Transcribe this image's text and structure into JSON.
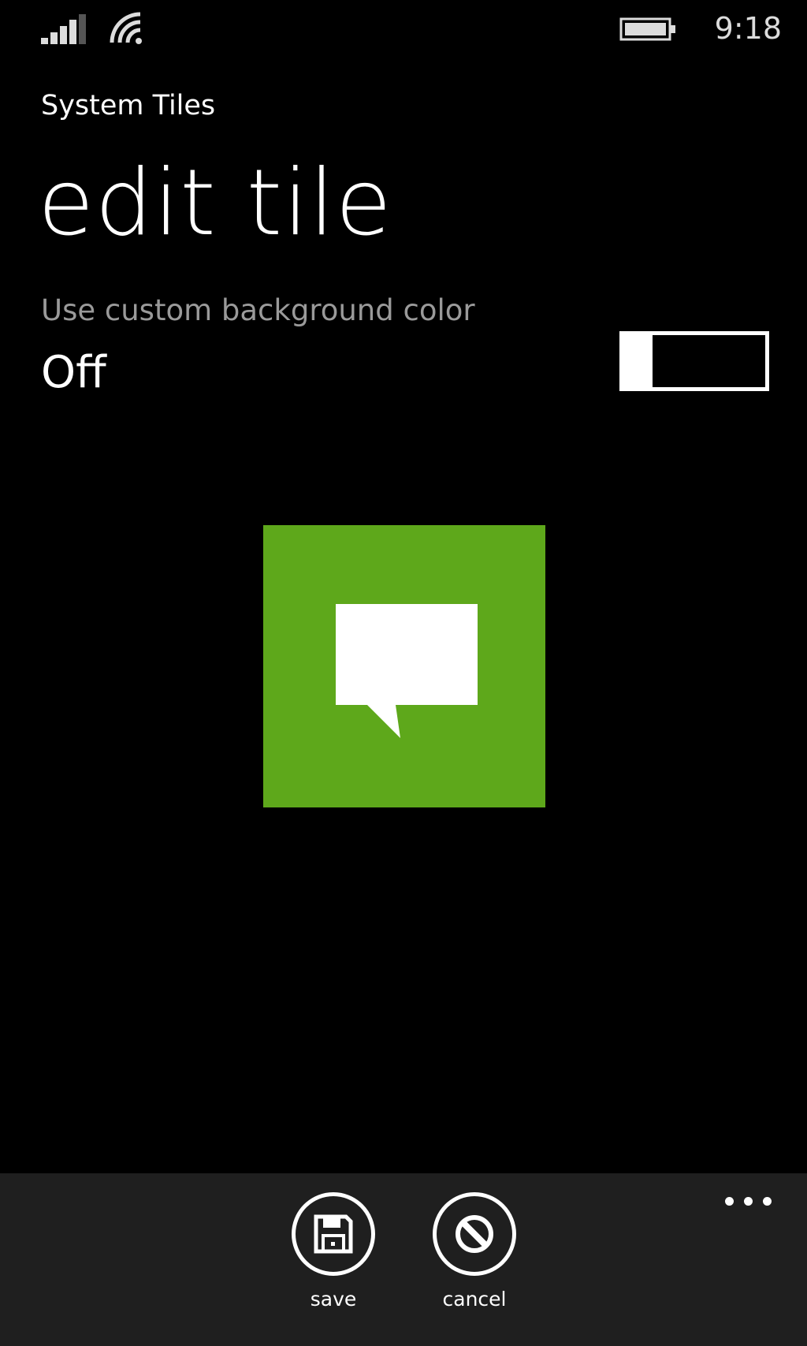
{
  "status_bar": {
    "time": "9:18",
    "icons": [
      "signal-strength-icon",
      "wifi-icon",
      "battery-icon"
    ]
  },
  "header": {
    "app_title": "System Tiles",
    "page_title": "edit tile"
  },
  "setting": {
    "label": "Use custom background color",
    "value": "Off",
    "enabled": false
  },
  "tile": {
    "background_color": "#5ea81b",
    "icon": "message-bubble-icon"
  },
  "app_bar": {
    "buttons": [
      {
        "label": "save",
        "icon": "save-icon"
      },
      {
        "label": "cancel",
        "icon": "cancel-icon"
      }
    ],
    "more_icon": "more-dots-icon"
  },
  "colors": {
    "background": "#000000",
    "app_bar": "#1f1f1f",
    "secondary_text": "#9a9a9a",
    "accent": "#5ea81b"
  }
}
